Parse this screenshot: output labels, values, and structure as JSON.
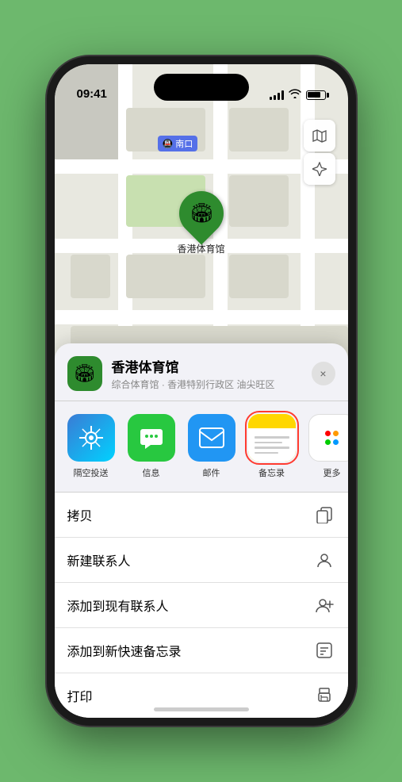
{
  "statusBar": {
    "time": "09:41",
    "arrow": "▲"
  },
  "mapControls": {
    "mapBtn": "🗺",
    "locationBtn": "➤"
  },
  "mapLabel": {
    "prefix": "南口",
    "icon": "🚇"
  },
  "stadiumPin": {
    "label": "香港体育馆",
    "emoji": "🏟"
  },
  "sheet": {
    "venueName": "香港体育馆",
    "venueSubtitle": "综合体育馆 · 香港特别行政区 油尖旺区",
    "closeBtn": "×"
  },
  "shareItems": [
    {
      "id": "airdrop",
      "label": "隔空投送",
      "type": "airdrop"
    },
    {
      "id": "messages",
      "label": "信息",
      "type": "messages"
    },
    {
      "id": "mail",
      "label": "邮件",
      "type": "mail"
    },
    {
      "id": "notes",
      "label": "备忘录",
      "type": "notes",
      "selected": true
    },
    {
      "id": "more",
      "label": "更多",
      "type": "more"
    }
  ],
  "menuItems": [
    {
      "id": "copy",
      "label": "拷贝",
      "icon": "copy"
    },
    {
      "id": "new-contact",
      "label": "新建联系人",
      "icon": "person"
    },
    {
      "id": "add-existing",
      "label": "添加到现有联系人",
      "icon": "person-add"
    },
    {
      "id": "quick-note",
      "label": "添加到新快速备忘录",
      "icon": "note"
    },
    {
      "id": "print",
      "label": "打印",
      "icon": "print"
    }
  ],
  "homeIndicator": {}
}
